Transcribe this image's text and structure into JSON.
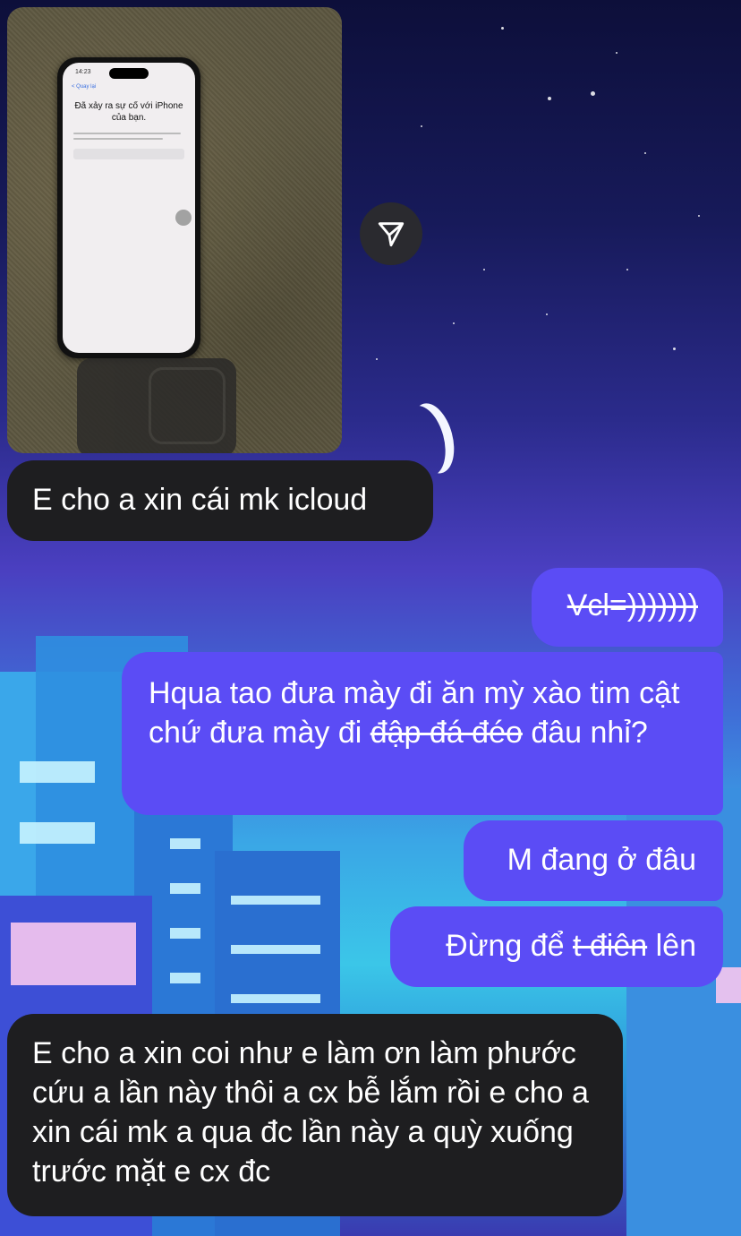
{
  "photo": {
    "phone_time": "14:23",
    "phone_back": "< Quay lại",
    "phone_title": "Đã xảy ra sự cố với iPhone của bạn."
  },
  "messages": [
    {
      "id": "m1",
      "from": "them",
      "text": "E cho a xin cái mk icloud"
    },
    {
      "id": "m2",
      "from": "me",
      "text": "Vcl=)))))))",
      "strikethrough": true
    },
    {
      "id": "m3",
      "from": "me",
      "parts": {
        "before": "Hqua tao đưa mày đi ăn mỳ xào tim cật chứ đưa mày đi ",
        "struck": "đập đá đéo",
        "after": " đâu nhỉ?"
      }
    },
    {
      "id": "m4",
      "from": "me",
      "text": "M đang ở đâu"
    },
    {
      "id": "m5",
      "from": "me",
      "parts": {
        "before": "Đừng để ",
        "struck": "t điên",
        "after": " lên"
      }
    },
    {
      "id": "m6",
      "from": "them",
      "text": "E cho a xin coi như e làm ơn làm phước cứu a lần này thôi a cx bễ lắm rồi e cho a xin cái mk a qua đc lần này a quỳ xuống trước mặt e cx đc"
    }
  ],
  "icons": {
    "share": "send-paper-plane-icon"
  },
  "colors": {
    "sent": "#5b4cf5",
    "received": "#1e1e20"
  }
}
